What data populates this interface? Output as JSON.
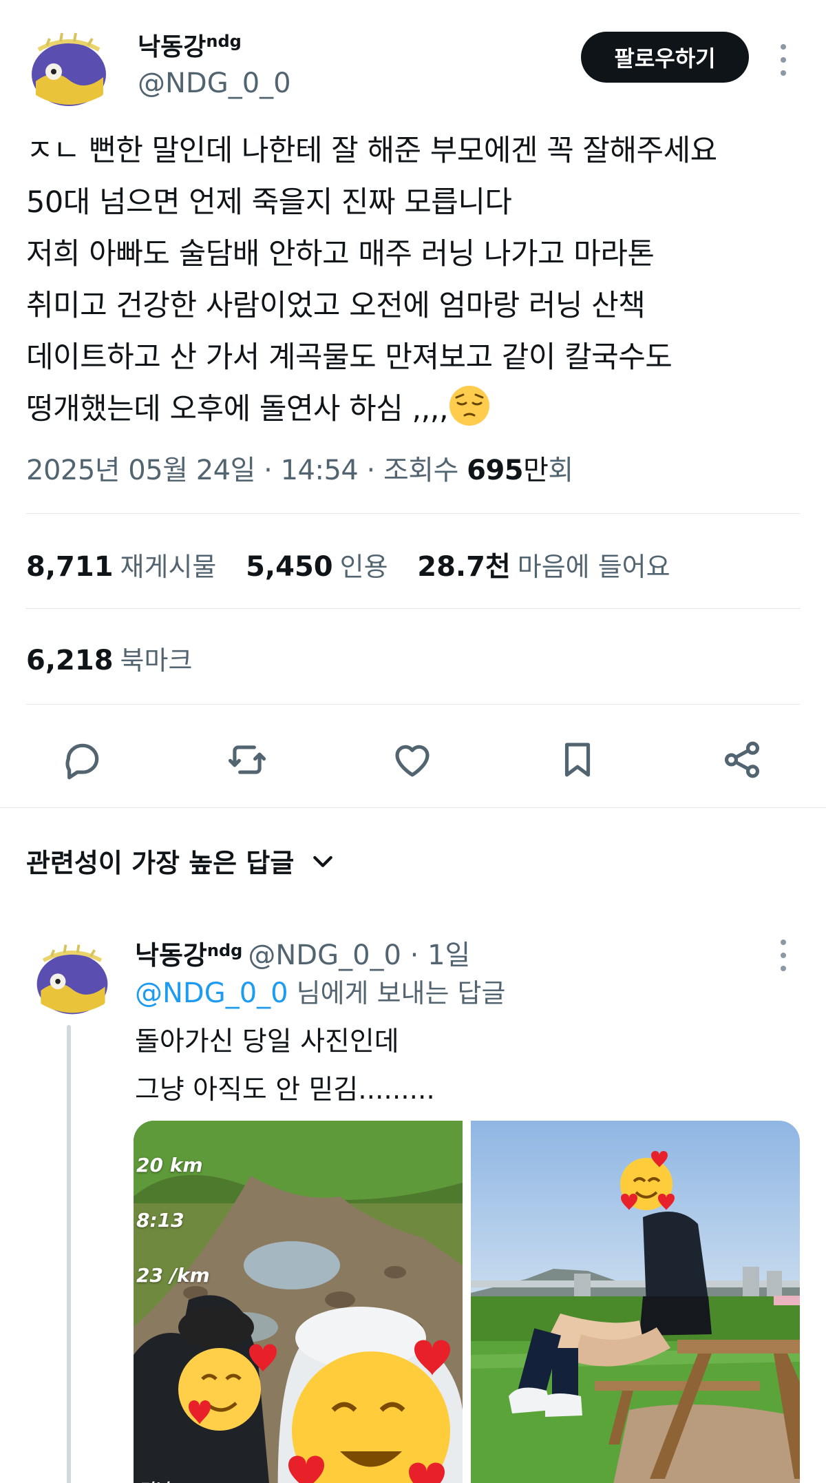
{
  "author": {
    "display_name": "낙동강",
    "name_suffix": "ndg",
    "handle": "@NDG_0_0",
    "follow_label": "팔로우하기"
  },
  "tweet": {
    "lines": [
      "ㅈㄴ 뻔한 말인데 나한테 잘 해준 부모에겐 꼭 잘해주세요",
      "50대 넘으면 언제 죽을지 진짜 모릅니다",
      "저희 아빠도 술담배 안하고 매주 러닝 나가고 마라톤",
      "취미고 건강한 사람이었고 오전에 엄마랑 러닝 산책",
      "데이트하고 산 가서 계곡물도 만져보고 같이 칼국수도",
      "떵개했는데 오후에 돌연사 하심 ,,,,"
    ],
    "emoji": "pensive-face",
    "timestamp": "2025년 05월 24일 · 14:54 · 조회수 ",
    "views_number": "695",
    "views_unit": "만",
    "views_suffix": "회"
  },
  "stats": {
    "retweets": {
      "num": "8,711",
      "label": "재게시물"
    },
    "quotes": {
      "num": "5,450",
      "label": "인용"
    },
    "likes": {
      "num": "28.7천",
      "label": "마음에 들어요"
    },
    "bookmarks": {
      "num": "6,218",
      "label": "북마크"
    }
  },
  "actions": [
    "reply-icon",
    "retweet-icon",
    "like-icon",
    "bookmark-icon",
    "share-icon"
  ],
  "replies_header": {
    "label": "관련성이 가장 높은 답글"
  },
  "reply": {
    "display_name": "낙동강",
    "name_suffix": "ndg",
    "handle_and_time": "@NDG_0_0 · 1일",
    "reply_to_mention": "@NDG_0_0",
    "reply_to_rest": "님에게 보내는 답글",
    "text_lines": [
      "돌아가신 당일 사진인데",
      "그냥 아직도 안 믿김........."
    ],
    "photo1_overlay": {
      "dist": "20 km",
      "time": "8:13",
      "pace": "23 /km",
      "caption": "러닝"
    }
  },
  "colors": {
    "text": "#0f1419",
    "secondary": "#536471",
    "link": "#1d9bf0",
    "button_bg": "#0f1419",
    "divider": "#e3e7ea"
  }
}
